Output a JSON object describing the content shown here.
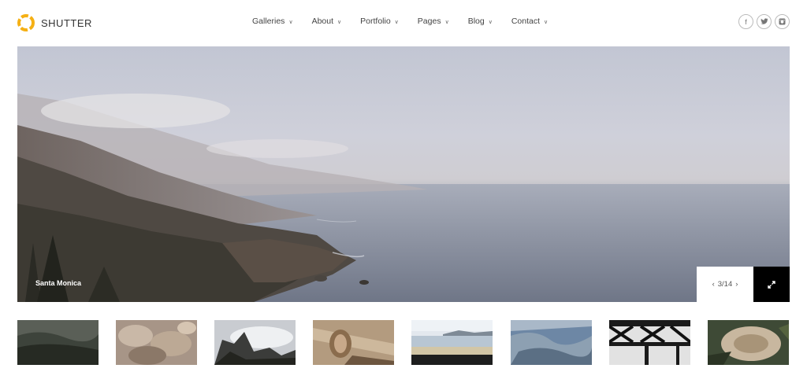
{
  "brand": {
    "name": "SHUTTER",
    "accent": "#f5b014"
  },
  "nav": {
    "items": [
      {
        "label": "Galleries",
        "icon": "chevron-down-icon"
      },
      {
        "label": "About",
        "icon": "chevron-down-icon"
      },
      {
        "label": "Portfolio",
        "icon": "chevron-down-icon"
      },
      {
        "label": "Pages",
        "icon": "chevron-down-icon"
      },
      {
        "label": "Blog",
        "icon": "chevron-down-icon"
      },
      {
        "label": "Contact",
        "icon": "chevron-down-icon"
      }
    ]
  },
  "social": [
    {
      "name": "facebook-icon",
      "glyph": "f"
    },
    {
      "name": "twitter-icon",
      "glyph": "t"
    },
    {
      "name": "instagram-icon",
      "glyph": "◘"
    }
  ],
  "hero": {
    "caption": "Santa Monica",
    "counter": "3/14",
    "prev_icon": "chevron-left-icon",
    "next_icon": "chevron-right-icon",
    "expand_icon": "expand-icon"
  },
  "thumbnails": [
    {
      "name": "misty-hills"
    },
    {
      "name": "rocks"
    },
    {
      "name": "mountain-clouds"
    },
    {
      "name": "driftwood"
    },
    {
      "name": "lake-horizon"
    },
    {
      "name": "aerial-town"
    },
    {
      "name": "steel-bridge"
    },
    {
      "name": "tree-stump"
    }
  ]
}
